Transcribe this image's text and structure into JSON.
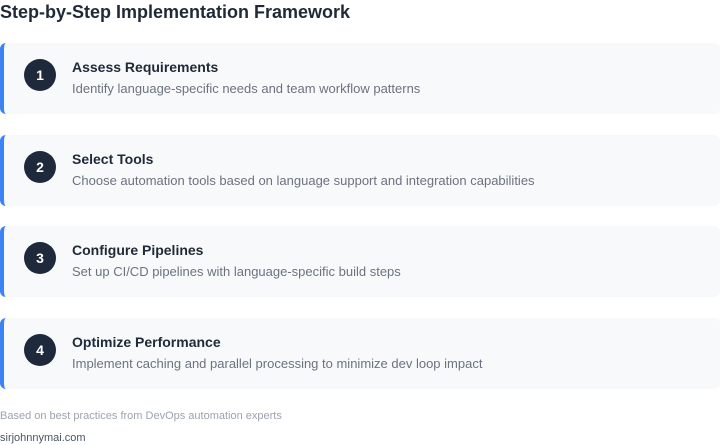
{
  "header": {
    "title": "Step-by-Step Implementation Framework"
  },
  "steps": [
    {
      "number": "1",
      "title": "Assess Requirements",
      "description": "Identify language-specific needs and team workflow patterns"
    },
    {
      "number": "2",
      "title": "Select Tools",
      "description": "Choose automation tools based on language support and integration capabilities"
    },
    {
      "number": "3",
      "title": "Configure Pipelines",
      "description": "Set up CI/CD pipelines with language-specific build steps"
    },
    {
      "number": "4",
      "title": "Optimize Performance",
      "description": "Implement caching and parallel processing to minimize dev loop impact"
    }
  ],
  "footer": {
    "note": "Based on best practices from DevOps automation experts",
    "source": "sirjohnnymai.com"
  },
  "colors": {
    "accent": "#3b82f6",
    "badge": "#1e293b",
    "card_background": "#f8f9fb"
  }
}
